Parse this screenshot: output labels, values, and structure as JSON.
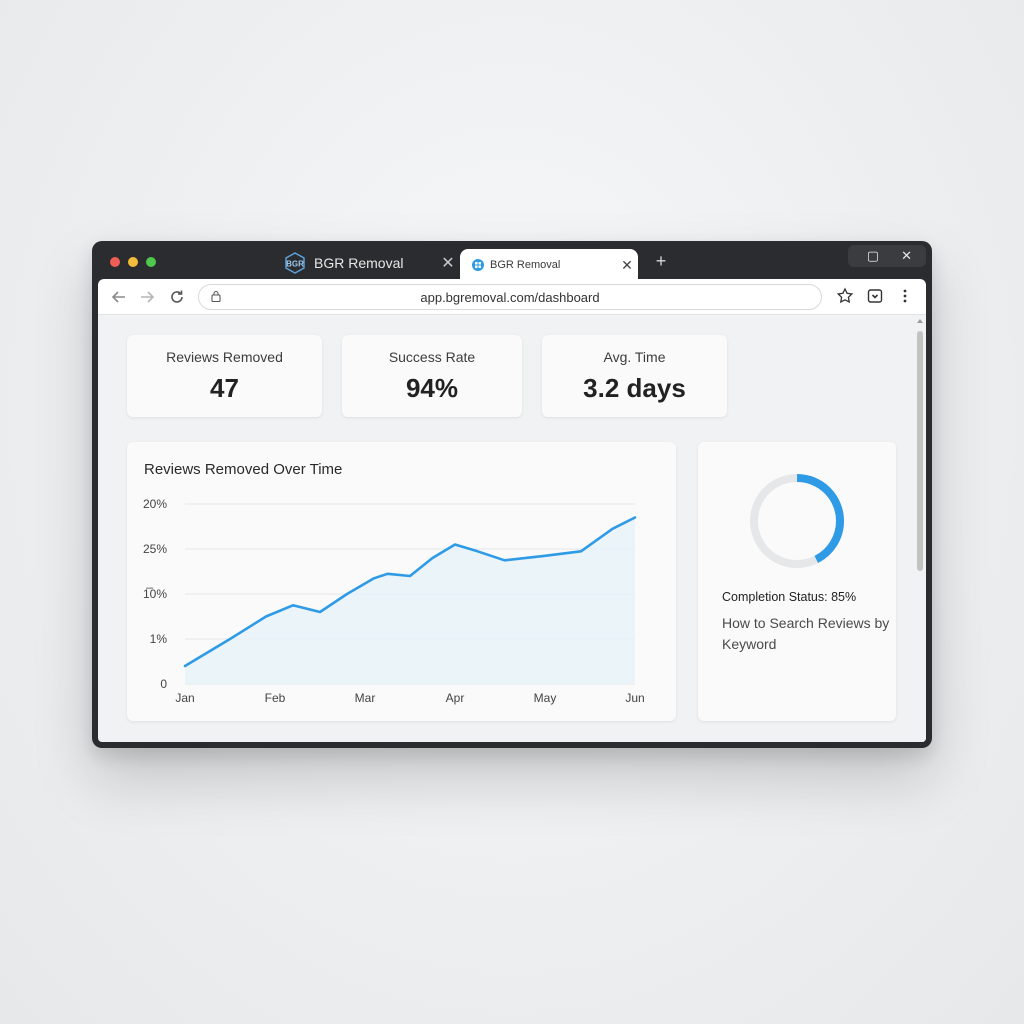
{
  "browser": {
    "tabs": [
      {
        "label": "BGR Removal",
        "active": false,
        "favicon_text": "BGR"
      },
      {
        "label": "BGR Removal",
        "active": true
      }
    ],
    "close_glyph": "✕",
    "new_tab_glyph": "+",
    "window_controls": {
      "maximize": "▢",
      "close": "✕"
    },
    "url": "app.bgremoval.com/dashboard"
  },
  "stats": [
    {
      "label": "Reviews Removed",
      "value": "47"
    },
    {
      "label": "Success Rate",
      "value": "94%"
    },
    {
      "label": "Avg. Time",
      "value": "3.2 days"
    }
  ],
  "status_card": {
    "status_text": "Completion Status: 85%",
    "completion": 0.85,
    "help_link": "How to Search Reviews by Keyword"
  },
  "colors": {
    "accent": "#2f9be6",
    "area_fill": "#e7f2f8",
    "ring_track": "#e6e7e9"
  },
  "chart_data": {
    "type": "line",
    "title": "Reviews Removed Over Time",
    "y_tick_labels": [
      "0",
      "1%",
      "1̅0%",
      "25%",
      "20%"
    ],
    "x_tick_labels": [
      "Jan",
      "Feb",
      "Mar",
      "Apr",
      "May",
      "Jun"
    ],
    "grid": true,
    "series": [
      {
        "x": [
          0,
          0.25,
          0.5,
          0.9,
          1.2,
          1.5,
          1.8,
          2.1,
          2.25,
          2.5,
          2.75,
          3.0,
          3.25,
          3.55,
          4.0,
          4.4,
          4.75,
          5.0
        ],
        "y": [
          0.4,
          0.7,
          1.0,
          1.5,
          1.75,
          1.6,
          2.0,
          2.35,
          2.45,
          2.4,
          2.8,
          3.1,
          2.95,
          2.75,
          2.85,
          2.95,
          3.45,
          3.7
        ],
        "fill": true
      }
    ],
    "ylim": [
      0,
      4
    ]
  }
}
